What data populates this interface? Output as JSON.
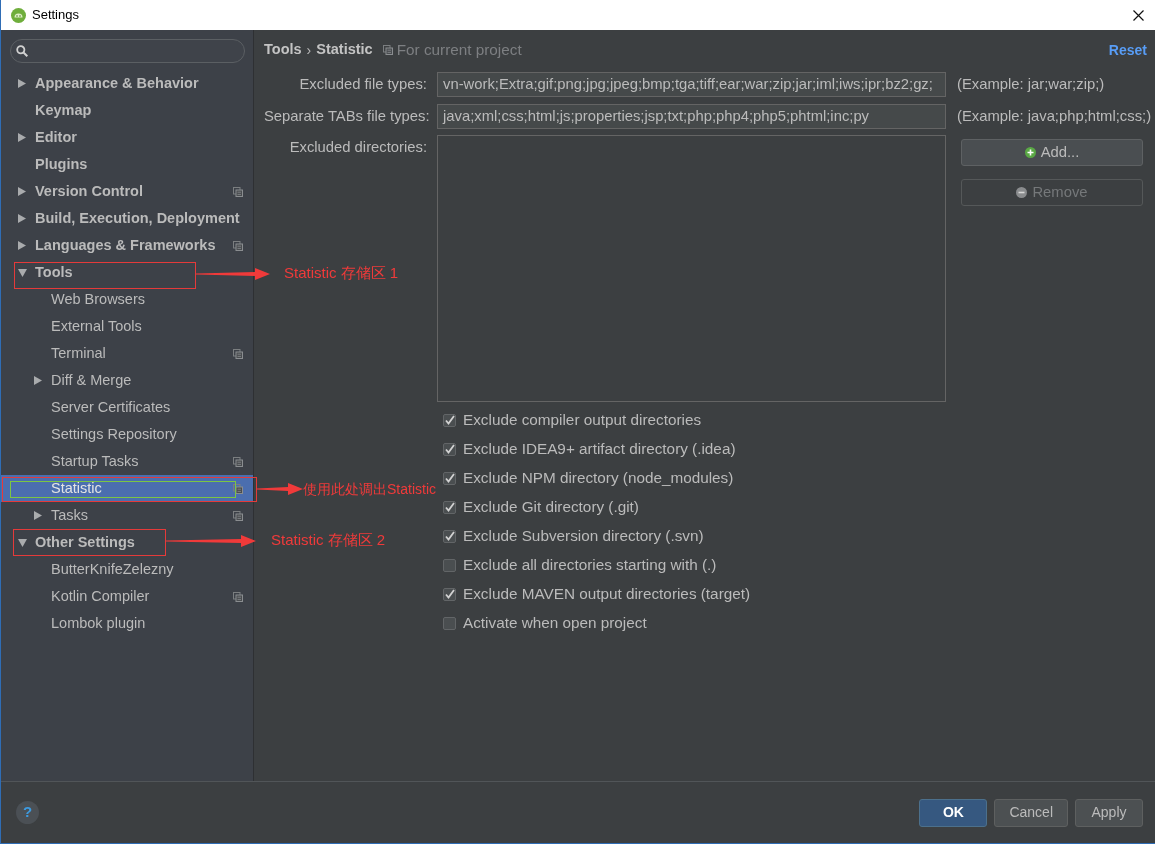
{
  "window": {
    "title": "Settings"
  },
  "sidebar": {
    "tree": [
      {
        "kind": "group",
        "label": "Appearance & Behavior",
        "expanded": false,
        "project_icon": false,
        "selected": false
      },
      {
        "kind": "page",
        "label": "Keymap",
        "project_icon": false,
        "selected": false
      },
      {
        "kind": "group",
        "label": "Editor",
        "expanded": false,
        "project_icon": false,
        "selected": false
      },
      {
        "kind": "page",
        "label": "Plugins",
        "project_icon": false,
        "selected": false
      },
      {
        "kind": "group",
        "label": "Version Control",
        "expanded": false,
        "project_icon": true,
        "selected": false
      },
      {
        "kind": "group",
        "label": "Build, Execution, Deployment",
        "expanded": false,
        "project_icon": false,
        "selected": false
      },
      {
        "kind": "group",
        "label": "Languages & Frameworks",
        "expanded": false,
        "project_icon": true,
        "selected": false
      },
      {
        "kind": "group",
        "label": "Tools",
        "expanded": true,
        "project_icon": false,
        "selected": false,
        "children": [
          {
            "kind": "page",
            "label": "Web Browsers",
            "project_icon": false,
            "selected": false
          },
          {
            "kind": "page",
            "label": "External Tools",
            "project_icon": false,
            "selected": false
          },
          {
            "kind": "page",
            "label": "Terminal",
            "project_icon": true,
            "selected": false
          },
          {
            "kind": "group",
            "label": "Diff & Merge",
            "expanded": false,
            "project_icon": false,
            "selected": false
          },
          {
            "kind": "page",
            "label": "Server Certificates",
            "project_icon": false,
            "selected": false
          },
          {
            "kind": "page",
            "label": "Settings Repository",
            "project_icon": false,
            "selected": false
          },
          {
            "kind": "page",
            "label": "Startup Tasks",
            "project_icon": true,
            "selected": false
          },
          {
            "kind": "page",
            "label": "Statistic",
            "project_icon": true,
            "selected": true
          },
          {
            "kind": "group",
            "label": "Tasks",
            "expanded": false,
            "project_icon": true,
            "selected": false
          }
        ]
      },
      {
        "kind": "group",
        "label": "Other Settings",
        "expanded": true,
        "project_icon": false,
        "selected": false,
        "children": [
          {
            "kind": "page",
            "label": "ButterKnifeZelezny",
            "project_icon": false,
            "selected": false
          },
          {
            "kind": "page",
            "label": "Kotlin Compiler",
            "project_icon": true,
            "selected": false
          },
          {
            "kind": "page",
            "label": "Lombok plugin",
            "project_icon": false,
            "selected": false
          }
        ]
      }
    ]
  },
  "panel": {
    "breadcrumb": [
      "Tools",
      "Statistic"
    ],
    "separator": "›",
    "scope_note": "For current project",
    "reset": "Reset",
    "fields": [
      {
        "label": "Excluded file types:",
        "value": "vn-work;Extra;gif;png;jpg;jpeg;bmp;tga;tiff;ear;war;zip;jar;iml;iws;ipr;bz2;gz;",
        "example": "(Example: jar;war;zip;)"
      },
      {
        "label": "Separate TABs file types:",
        "value": "java;xml;css;html;js;properties;jsp;txt;php;php4;php5;phtml;inc;py",
        "example": "(Example: java;php;html;css;)"
      }
    ],
    "excluded_directories": {
      "label": "Excluded directories:",
      "buttons": [
        {
          "kind": "add",
          "label": "Add...",
          "disabled": false
        },
        {
          "kind": "remove",
          "label": "Remove",
          "disabled": true
        }
      ]
    },
    "checkboxes": [
      {
        "label": "Exclude compiler output directories",
        "checked": true
      },
      {
        "label": "Exclude IDEA9+ artifact directory (.idea)",
        "checked": true
      },
      {
        "label": "Exclude NPM directory (node_modules)",
        "checked": true
      },
      {
        "label": "Exclude Git directory (.git)",
        "checked": true
      },
      {
        "label": "Exclude Subversion directory (.svn)",
        "checked": true
      },
      {
        "label": "Exclude all directories starting with (.)",
        "checked": false
      },
      {
        "label": "Exclude MAVEN output directories (target)",
        "checked": true
      },
      {
        "label": "Activate when open project",
        "checked": false
      }
    ]
  },
  "footer": {
    "help": "?",
    "buttons": [
      {
        "label": "OK",
        "default": true
      },
      {
        "label": "Cancel",
        "default": false
      },
      {
        "label": "Apply",
        "default": false
      }
    ]
  },
  "annotations": [
    {
      "text": "Statistic 存储区 1"
    },
    {
      "text": "使用此处调出Statistic"
    },
    {
      "text": "Statistic 存储区 2"
    }
  ]
}
